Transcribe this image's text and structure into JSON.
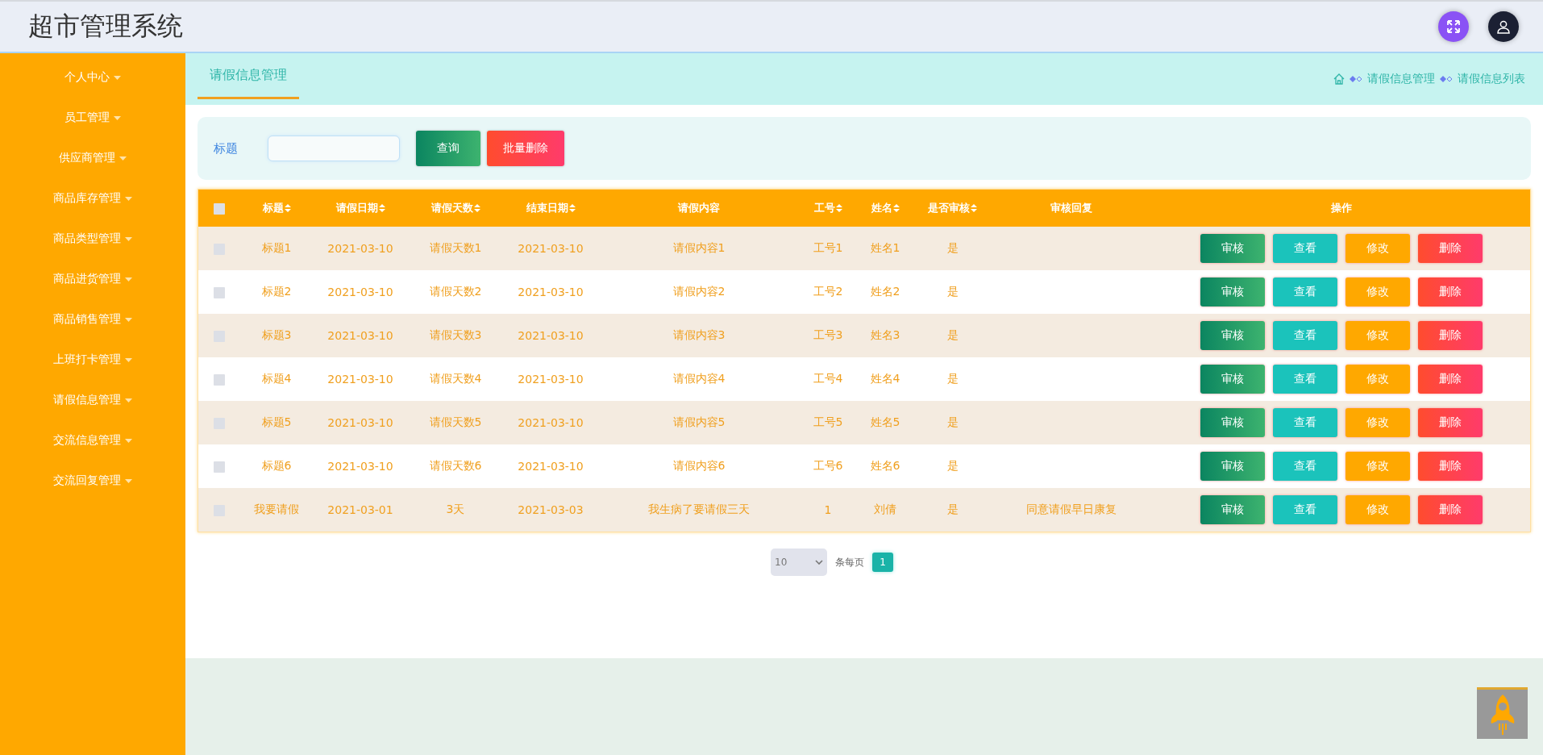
{
  "header": {
    "title": "超市管理系统"
  },
  "sidebar": {
    "items": [
      {
        "label": "个人中心"
      },
      {
        "label": "员工管理"
      },
      {
        "label": "供应商管理"
      },
      {
        "label": "商品库存管理"
      },
      {
        "label": "商品类型管理"
      },
      {
        "label": "商品进货管理"
      },
      {
        "label": "商品销售管理"
      },
      {
        "label": "上班打卡管理"
      },
      {
        "label": "请假信息管理"
      },
      {
        "label": "交流信息管理"
      },
      {
        "label": "交流回复管理"
      }
    ]
  },
  "tabs": [
    {
      "label": "请假信息管理",
      "selected": true
    }
  ],
  "breadcrumb": [
    "请假信息管理",
    "请假信息列表"
  ],
  "search": {
    "label": "标题",
    "buttons": [
      {
        "kind": "search",
        "label": "查询"
      },
      {
        "kind": "delete",
        "label": "批量删除"
      }
    ]
  },
  "table": {
    "select_all_checked": false,
    "columns": [
      {
        "label": "标题",
        "sortable": true
      },
      {
        "label": "请假日期",
        "sortable": true
      },
      {
        "label": "请假天数",
        "sortable": true
      },
      {
        "label": "结束日期",
        "sortable": true
      },
      {
        "label": "请假内容",
        "sortable": false
      },
      {
        "label": "工号",
        "sortable": true
      },
      {
        "label": "姓名",
        "sortable": true
      },
      {
        "label": "是否审核",
        "sortable": true
      },
      {
        "label": "审核回复",
        "sortable": false
      },
      {
        "label": "操作",
        "sortable": false
      }
    ],
    "rows": [
      {
        "checked": false,
        "cells": [
          "标题1",
          "2021-03-10",
          "请假天数1",
          "2021-03-10",
          "请假内容1",
          "工号1",
          "姓名1",
          "是",
          ""
        ],
        "actions": [
          {
            "kind": "audit",
            "label": "审核"
          },
          {
            "kind": "view",
            "label": "查看"
          },
          {
            "kind": "edit",
            "label": "修改"
          },
          {
            "kind": "delete",
            "label": "删除"
          }
        ]
      },
      {
        "checked": false,
        "cells": [
          "标题2",
          "2021-03-10",
          "请假天数2",
          "2021-03-10",
          "请假内容2",
          "工号2",
          "姓名2",
          "是",
          ""
        ],
        "actions": [
          {
            "kind": "audit",
            "label": "审核"
          },
          {
            "kind": "view",
            "label": "查看"
          },
          {
            "kind": "edit",
            "label": "修改"
          },
          {
            "kind": "delete",
            "label": "删除"
          }
        ]
      },
      {
        "checked": false,
        "cells": [
          "标题3",
          "2021-03-10",
          "请假天数3",
          "2021-03-10",
          "请假内容3",
          "工号3",
          "姓名3",
          "是",
          ""
        ],
        "actions": [
          {
            "kind": "audit",
            "label": "审核"
          },
          {
            "kind": "view",
            "label": "查看"
          },
          {
            "kind": "edit",
            "label": "修改"
          },
          {
            "kind": "delete",
            "label": "删除"
          }
        ]
      },
      {
        "checked": false,
        "cells": [
          "标题4",
          "2021-03-10",
          "请假天数4",
          "2021-03-10",
          "请假内容4",
          "工号4",
          "姓名4",
          "是",
          ""
        ],
        "actions": [
          {
            "kind": "audit",
            "label": "审核"
          },
          {
            "kind": "view",
            "label": "查看"
          },
          {
            "kind": "edit",
            "label": "修改"
          },
          {
            "kind": "delete",
            "label": "删除"
          }
        ]
      },
      {
        "checked": false,
        "cells": [
          "标题5",
          "2021-03-10",
          "请假天数5",
          "2021-03-10",
          "请假内容5",
          "工号5",
          "姓名5",
          "是",
          ""
        ],
        "actions": [
          {
            "kind": "audit",
            "label": "审核"
          },
          {
            "kind": "view",
            "label": "查看"
          },
          {
            "kind": "edit",
            "label": "修改"
          },
          {
            "kind": "delete",
            "label": "删除"
          }
        ]
      },
      {
        "checked": false,
        "cells": [
          "标题6",
          "2021-03-10",
          "请假天数6",
          "2021-03-10",
          "请假内容6",
          "工号6",
          "姓名6",
          "是",
          ""
        ],
        "actions": [
          {
            "kind": "audit",
            "label": "审核"
          },
          {
            "kind": "view",
            "label": "查看"
          },
          {
            "kind": "edit",
            "label": "修改"
          },
          {
            "kind": "delete",
            "label": "删除"
          }
        ]
      },
      {
        "checked": false,
        "cells": [
          "我要请假",
          "2021-03-01",
          "3天",
          "2021-03-03",
          "我生病了要请假三天",
          "1",
          "刘倩",
          "是",
          "同意请假早日康复"
        ],
        "actions": [
          {
            "kind": "audit",
            "label": "审核"
          },
          {
            "kind": "view",
            "label": "查看"
          },
          {
            "kind": "edit",
            "label": "修改"
          },
          {
            "kind": "delete",
            "label": "删除"
          }
        ]
      }
    ]
  },
  "pagination": {
    "page_size": "10",
    "per_page_label": "条每页",
    "pages": [
      {
        "label": "1",
        "selected": true
      }
    ]
  }
}
